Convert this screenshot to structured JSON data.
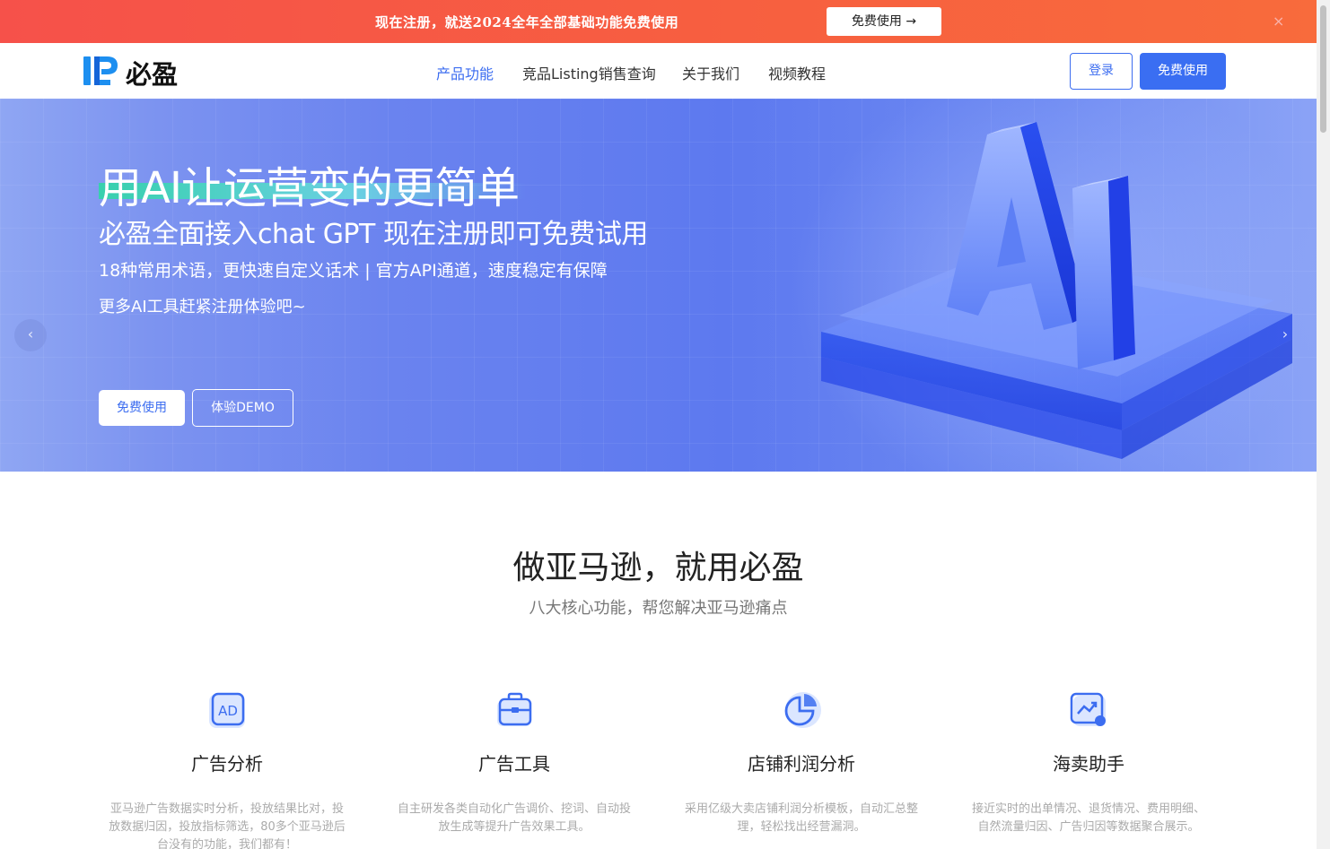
{
  "promo": {
    "text": "现在注册，就送2024全年全部基础功能免费使用",
    "button": "免费使用 →",
    "close": "×"
  },
  "header": {
    "brand": "必盈",
    "nav": [
      "产品功能",
      "竞品Listing销售查询",
      "关于我们",
      "视频教程"
    ],
    "login": "登录",
    "free": "免费使用"
  },
  "hero": {
    "title": "用AI让运营变的更简单",
    "subtitle": "必盈全面接入chat GPT 现在注册即可免费试用",
    "line3": "18种常用术语，更快速自定义话术 | 官方API通道，速度稳定有保障",
    "line4": "更多AI工具赶紧注册体验吧~",
    "btn_free": "免费使用",
    "btn_demo": "体验DEMO",
    "prev": "‹",
    "next": "›"
  },
  "section": {
    "title": "做亚马逊，就用必盈",
    "subtitle": "八大核心功能，帮您解决亚马逊痛点"
  },
  "features": [
    {
      "icon": "ad-icon",
      "title": "广告分析",
      "desc": "亚马逊广告数据实时分析，投放结果比对，投放数据归因，投放指标筛选，80多个亚马逊后台没有的功能，我们都有！"
    },
    {
      "icon": "briefcase-icon",
      "title": "广告工具",
      "desc": "自主研发各类自动化广告调价、挖词、自动投放生成等提升广告效果工具。"
    },
    {
      "icon": "pie-chart-icon",
      "title": "店铺利润分析",
      "desc": "采用亿级大卖店铺利润分析模板，自动汇总整理，轻松找出经营漏洞。"
    },
    {
      "icon": "trend-chart-icon",
      "title": "海卖助手",
      "desc": "接近实时的出单情况、退货情况、费用明细、自然流量归因、广告归因等数据聚合展示。"
    }
  ],
  "colors": {
    "promo": "#f6514a",
    "accent": "#3c6df0",
    "hero": "#6a83ef",
    "highlight": "#2fd6a6"
  }
}
